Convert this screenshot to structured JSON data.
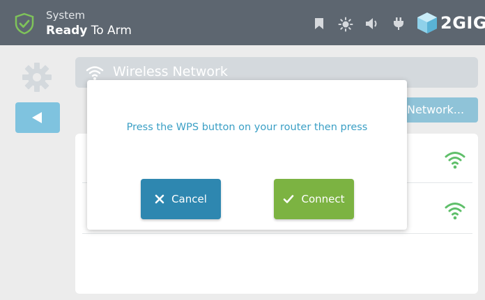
{
  "header": {
    "system_label": "System",
    "status_bold": "Ready",
    "status_rest": " To Arm",
    "brand": "2GIG",
    "icons": [
      "shield-check-icon",
      "bookmark-icon",
      "brightness-icon",
      "volume-icon",
      "power-plug-icon",
      "brand-logo-icon"
    ]
  },
  "sidebar": {
    "icons": [
      "gear-icon",
      "back-arrow-icon"
    ]
  },
  "main": {
    "network_bar_label": "Wireless Network",
    "add_network_label": "Network...",
    "network_rows": [
      {
        "icon": "wifi-signal-icon"
      },
      {
        "icon": "wifi-signal-icon"
      }
    ]
  },
  "modal": {
    "message": "Press the WPS button on your router then press",
    "cancel_label": "Cancel",
    "connect_label": "Connect"
  },
  "colors": {
    "header_bg": "#5d6670",
    "accent_blue": "#2e87b0",
    "accent_green": "#7cb342",
    "message_text": "#3a9fc5",
    "wifi_green": "#5fbf6a",
    "shield_green": "#7fc35a"
  }
}
